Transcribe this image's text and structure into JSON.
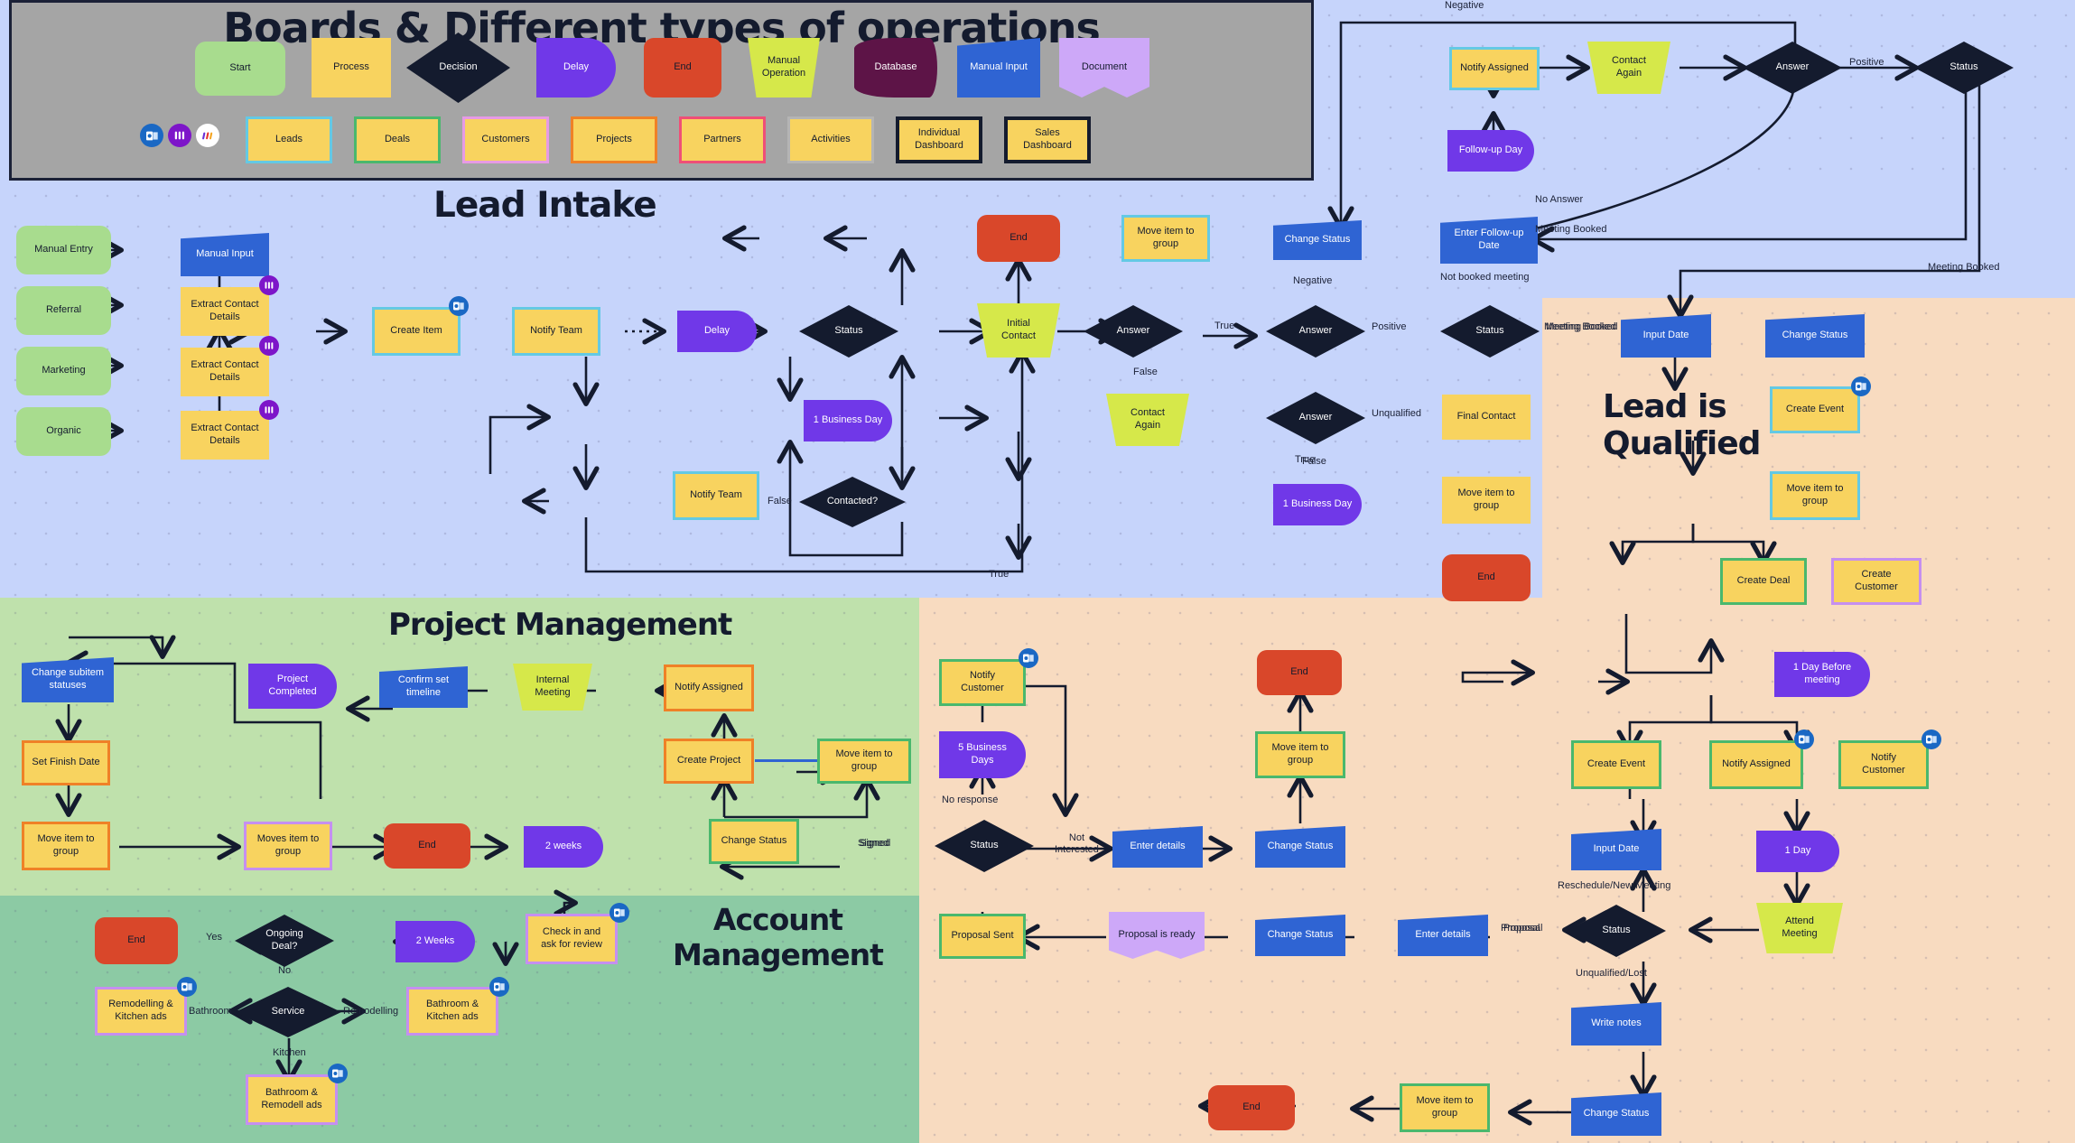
{
  "header": {
    "title": "Boards & Different types of operations",
    "legend_shapes": [
      {
        "label": "Start",
        "shape": "start"
      },
      {
        "label": "Process",
        "shape": "process"
      },
      {
        "label": "Decision",
        "shape": "decision"
      },
      {
        "label": "Delay",
        "shape": "delay"
      },
      {
        "label": "End",
        "shape": "end"
      },
      {
        "label": "Manual\nOperation",
        "shape": "manual-operation"
      },
      {
        "label": "Database",
        "shape": "database"
      },
      {
        "label": "Manual Input",
        "shape": "manual-input"
      },
      {
        "label": "Document",
        "shape": "document"
      }
    ],
    "board_icons": [
      "outlook-icon",
      "monday-icon",
      "make-icon"
    ],
    "boards": [
      {
        "label": "Leads",
        "accent": "#64c9e4"
      },
      {
        "label": "Deals",
        "accent": "#4ab86d"
      },
      {
        "label": "Customers",
        "accent": "#e79ae5"
      },
      {
        "label": "Projects",
        "accent": "#ef8127"
      },
      {
        "label": "Partners",
        "accent": "#ef4f77"
      },
      {
        "label": "Activities",
        "accent": "#b4b4b4"
      },
      {
        "label": "Individual\nDashboard",
        "accent": "#141b2e"
      },
      {
        "label": "Sales\nDashboard",
        "accent": "#141b2e"
      }
    ]
  },
  "sections": {
    "lead_intake": "Lead Intake",
    "project_management": "Project Management",
    "account_management": "Account\nManagement",
    "lead_qualified": "Lead is\nQualified"
  },
  "lead_intake": {
    "sources": [
      "Manual Entry",
      "Referral",
      "Marketing",
      "Organic"
    ],
    "manual_input": "Manual Input",
    "extract": [
      "Extract Contact\nDetails",
      "Extract Contact\nDetails",
      "Extract Contact\nDetails"
    ],
    "create_item": "Create Item",
    "notify_team": "Notify Team",
    "delay": "Delay",
    "status": "Status",
    "business_day": "1 Business Day",
    "contacted": "Contacted?",
    "notify_team_2": "Notify Team",
    "initial_contact": "Initial\nContact",
    "answer_1": "Answer",
    "contact_again": "Contact\nAgain",
    "answer_2": "Answer",
    "answer_3": "Answer",
    "change_status": "Change Status",
    "move_item": "Move item to\ngroup",
    "end": "End",
    "status_2": "Status",
    "final_contact": "Final Contact",
    "move_item_2": "Move item to\ngroup",
    "end_2": "End",
    "business_day_2": "1 Business Day",
    "enter_followup_date": "Enter Follow-up\nDate",
    "labels": {
      "false_1": "False",
      "true_1": "True",
      "true_2": "True",
      "true_3": "True",
      "false_2": "False",
      "false_3": "False",
      "negative_1": "Negative",
      "positive_1": "Positive",
      "unqualified": "Unqualified",
      "not_booked": "Not booked meeting",
      "meeting_booked": "Meeting Booked"
    }
  },
  "top_right": {
    "notify_assigned": "Notify Assigned",
    "follow_up_day": "Follow-up Day",
    "contact_again": "Contact\nAgain",
    "answer": "Answer",
    "status": "Status",
    "labels": {
      "negative": "Negative",
      "positive": "Positive",
      "no_answer": "No Answer",
      "meeting_booked": "Meeting Booked"
    }
  },
  "lead_qualified": {
    "input_date": "Input Date",
    "change_status": "Change Status",
    "create_event": "Create Event",
    "move_item": "Move item to\ngroup",
    "create_deal": "Create Deal",
    "create_customer": "Create\nCustomer",
    "one_day_before": "1 Day Before\nmeeting",
    "create_event_2": "Create Event",
    "notify_assigned": "Notify Assigned",
    "notify_customer": "Notify\nCustomer",
    "input_date_2": "Input Date",
    "one_day": "1 Day",
    "attend_meeting": "Attend\nMeeting",
    "status": "Status",
    "write_notes": "Write notes",
    "change_status_2": "Change Status",
    "labels": {
      "meeting_booked": "Meeting Booked",
      "reschedule": "Reschedule/New Meeting",
      "proposal": "Proposal",
      "unqualified_lost": "Unqualified/Lost"
    }
  },
  "project_management": {
    "change_subitem": "Change subitem\nstatuses",
    "set_finish_date": "Set Finish Date",
    "move_item": "Move item to\ngroup",
    "moves_item": "Moves item to\ngroup",
    "end": "End",
    "two_weeks": "2 weeks",
    "project_completed": "Project\nCompleted",
    "confirm_timeline": "Confirm set\ntimeline",
    "internal_meeting": "Internal\nMeeting",
    "notify_assigned": "Notify Assigned",
    "create_project": "Create Project",
    "move_item_2": "Move item to\ngroup",
    "change_status": "Change Status",
    "labels": {
      "signed": "Signed"
    }
  },
  "account_management": {
    "end": "End",
    "ongoing_deal": "Ongoing\nDeal?",
    "two_weeks": "2 Weeks",
    "check_in": "Check in and\nask for review",
    "service": "Service",
    "ads_bathroom": "Remodelling &\nKitchen ads",
    "ads_remodelling": "Bathroom &\nKitchen ads",
    "ads_kitchen": "Bathroom &\nRemodell ads",
    "labels": {
      "yes": "Yes",
      "no": "No",
      "bathroom": "Bathroom",
      "remodelling": "Remodelling",
      "kitchen": "Kitchen"
    }
  },
  "sales_flow": {
    "notify_customer": "Notify\nCustomer",
    "five_business_days": "5 Business\nDays",
    "status": "Status",
    "enter_details": "Enter details",
    "change_status": "Change Status",
    "move_item": "Move item to\ngroup",
    "end": "End",
    "proposal_sent": "Proposal Sent",
    "proposal_ready": "Proposal is ready",
    "change_status_2": "Change Status",
    "enter_details_2": "Enter details",
    "move_item_2": "Move item to\ngroup",
    "end_2": "End",
    "change_status_3": "Change Status",
    "labels": {
      "no_response": "No response",
      "not_interested": "Not\nInterested",
      "signed": "Signed",
      "proposal": "Proposal"
    }
  },
  "colors": {
    "start": "#a8dc8e",
    "process": "#f8d35f",
    "decision": "#141b2e",
    "delay": "#7038e8",
    "end": "#d9472a",
    "manual_operation": "#d6e84a",
    "database": "#5d1447",
    "manual_input": "#2f64d3",
    "document": "#cda8f8",
    "bg_lead": "#c6d4fb",
    "bg_project": "#bfe1ac",
    "bg_account": "#8ccaa4",
    "bg_qualified": "#f8dbc0",
    "bg_header": "#a5a5a5"
  }
}
